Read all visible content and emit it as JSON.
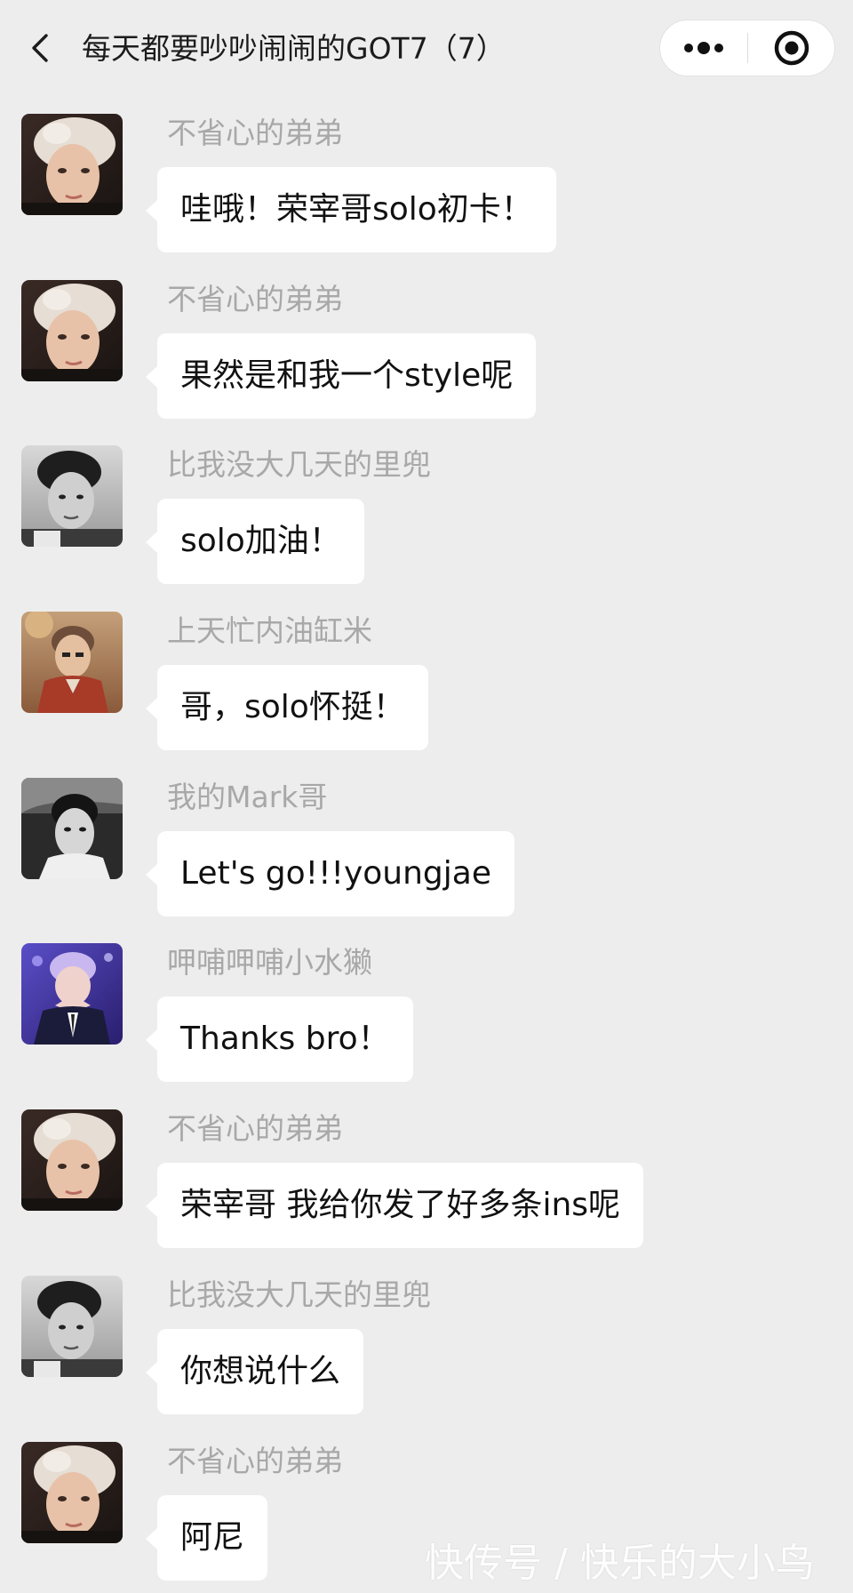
{
  "header": {
    "title": "每天都要吵吵闹闹的GOT7（7）",
    "back_icon": "chevron-left-icon",
    "more_icon": "more-dots-icon",
    "close_icon": "target-circle-icon"
  },
  "messages": [
    {
      "sender": "不省心的弟弟",
      "text": "哇哦！荣宰哥solo初卡！",
      "avatar": "platinum-hair-avatar"
    },
    {
      "sender": "不省心的弟弟",
      "text": "果然是和我一个style呢",
      "avatar": "platinum-hair-avatar"
    },
    {
      "sender": "比我没大几天的里兜",
      "text": "solo加油！",
      "avatar": "monochrome-portrait-avatar"
    },
    {
      "sender": "上天忙内油缸米",
      "text": "哥，solo怀挺！",
      "avatar": "brown-sweater-avatar"
    },
    {
      "sender": "我的Mark哥",
      "text": "Let's go!!!youngjae",
      "avatar": "black-white-car-avatar"
    },
    {
      "sender": "呷哺呷哺小水獭",
      "text": "Thanks bro！",
      "avatar": "purple-stage-avatar"
    },
    {
      "sender": "不省心的弟弟",
      "text": "荣宰哥 我给你发了好多条ins呢",
      "avatar": "platinum-hair-avatar"
    },
    {
      "sender": "比我没大几天的里兜",
      "text": "你想说什么",
      "avatar": "monochrome-portrait-avatar"
    },
    {
      "sender": "不省心的弟弟",
      "text": "阿尼",
      "avatar": "platinum-hair-avatar"
    }
  ],
  "watermark": "快传号 / 快乐的大小鸟",
  "colors": {
    "background": "#ededed",
    "bubble": "#ffffff",
    "sender_text": "#a8a8a8",
    "message_text": "#111111"
  }
}
